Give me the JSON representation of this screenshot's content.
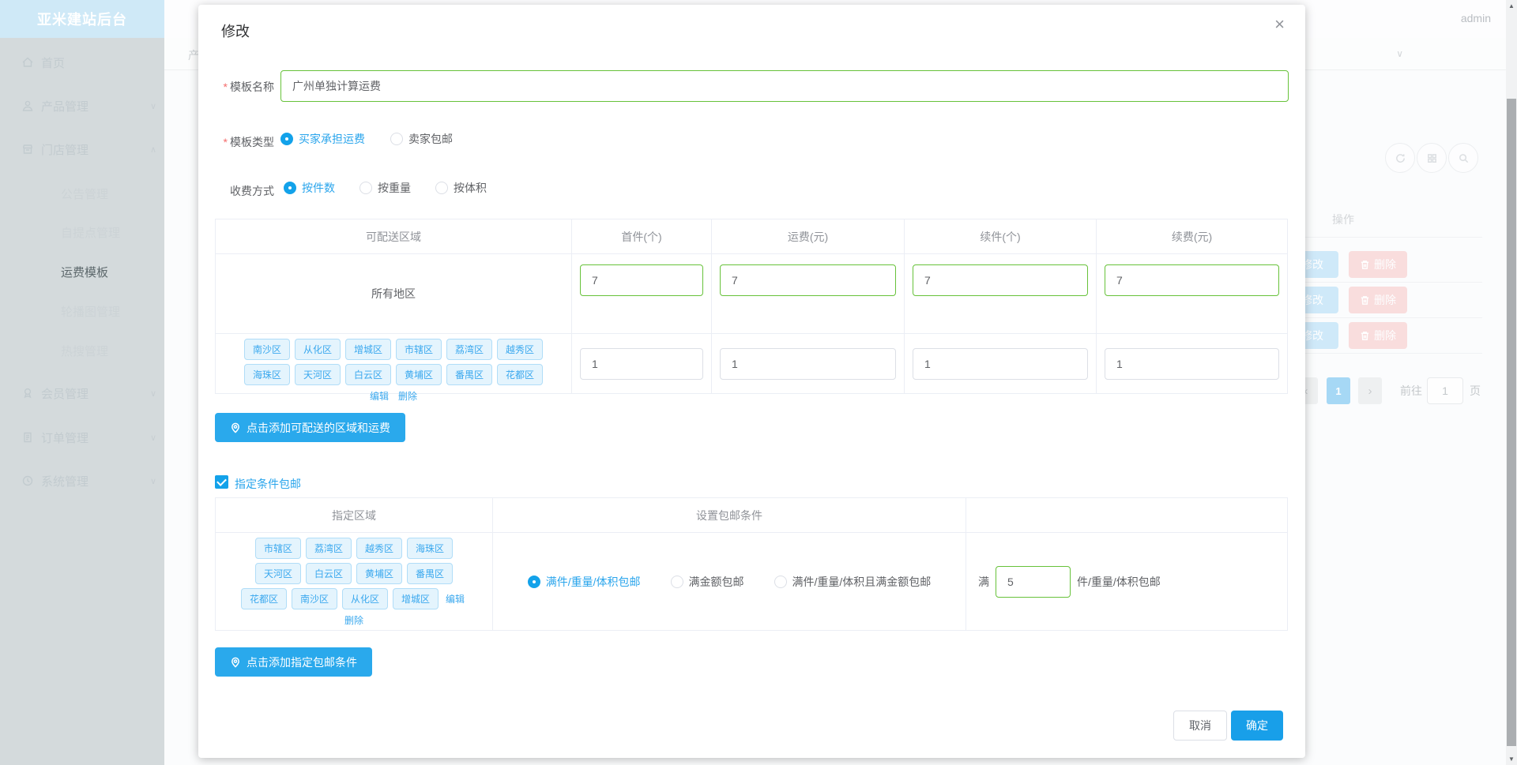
{
  "sidebar": {
    "logo": "亚米建站后台",
    "items": [
      {
        "label": "首页"
      },
      {
        "label": "产品管理"
      },
      {
        "label": "门店管理"
      },
      {
        "label": "公告管理"
      },
      {
        "label": "自提点管理"
      },
      {
        "label": "运费模板"
      },
      {
        "label": "轮播图管理"
      },
      {
        "label": "热搜管理"
      },
      {
        "label": "会员管理"
      },
      {
        "label": "订单管理"
      },
      {
        "label": "系统管理"
      }
    ]
  },
  "topbar": {
    "username": "admin"
  },
  "background": {
    "partial_text": "产",
    "ops_header": "操作",
    "modify_button": "修改",
    "delete_button": "删除",
    "pagination": {
      "prev": "‹",
      "page": "1",
      "next": "›",
      "goto_label": "前往",
      "goto_value": "1",
      "page_unit": "页"
    }
  },
  "modal": {
    "title": "修改",
    "close": "×",
    "name_field": {
      "required": "*",
      "label": "模板名称",
      "value": "广州单独计算运费"
    },
    "type_field": {
      "required": "*",
      "label": "模板类型",
      "options": [
        "买家承担运费",
        "卖家包邮"
      ],
      "selected": "买家承担运费"
    },
    "charge_field": {
      "label": "收费方式",
      "options": [
        "按件数",
        "按重量",
        "按体积"
      ],
      "selected": "按件数"
    },
    "table1": {
      "headers": [
        "可配送区域",
        "首件(个)",
        "运费(元)",
        "续件(个)",
        "续费(元)"
      ],
      "row_all": {
        "region": "所有地区",
        "first": "7",
        "fee": "7",
        "additional": "7",
        "additional_fee": "7"
      },
      "row_districts": {
        "tags": [
          "南沙区",
          "从化区",
          "增城区",
          "市辖区",
          "荔湾区",
          "越秀区",
          "海珠区",
          "天河区",
          "白云区",
          "黄埔区",
          "番禺区",
          "花都区"
        ],
        "edit": "编辑",
        "delete": "删除",
        "first": "1",
        "fee": "1",
        "additional": "1",
        "additional_fee": "1"
      }
    },
    "add_region_button": "点击添加可配送的区域和运费",
    "conditional_free": {
      "checkbox_label": "指定条件包邮",
      "table": {
        "headers": [
          "指定区域",
          "设置包邮条件"
        ],
        "tags": [
          "市辖区",
          "荔湾区",
          "越秀区",
          "海珠区",
          "天河区",
          "白云区",
          "黄埔区",
          "番禺区",
          "花都区",
          "南沙区",
          "从化区",
          "增城区"
        ],
        "edit": "编辑",
        "delete": "删除",
        "options": [
          "满件/重量/体积包邮",
          "满金额包邮",
          "满件/重量/体积且满金额包邮"
        ],
        "selected": "满件/重量/体积包邮",
        "prefix": "满",
        "value": "5",
        "suffix": "件/重量/体积包邮"
      }
    },
    "add_condition_button": "点击添加指定包邮条件",
    "footer": {
      "cancel": "取消",
      "confirm": "确定"
    }
  },
  "colors": {
    "primary": "#2aa9ec",
    "success_border": "#67c23a",
    "link": "#3aa8ee"
  }
}
